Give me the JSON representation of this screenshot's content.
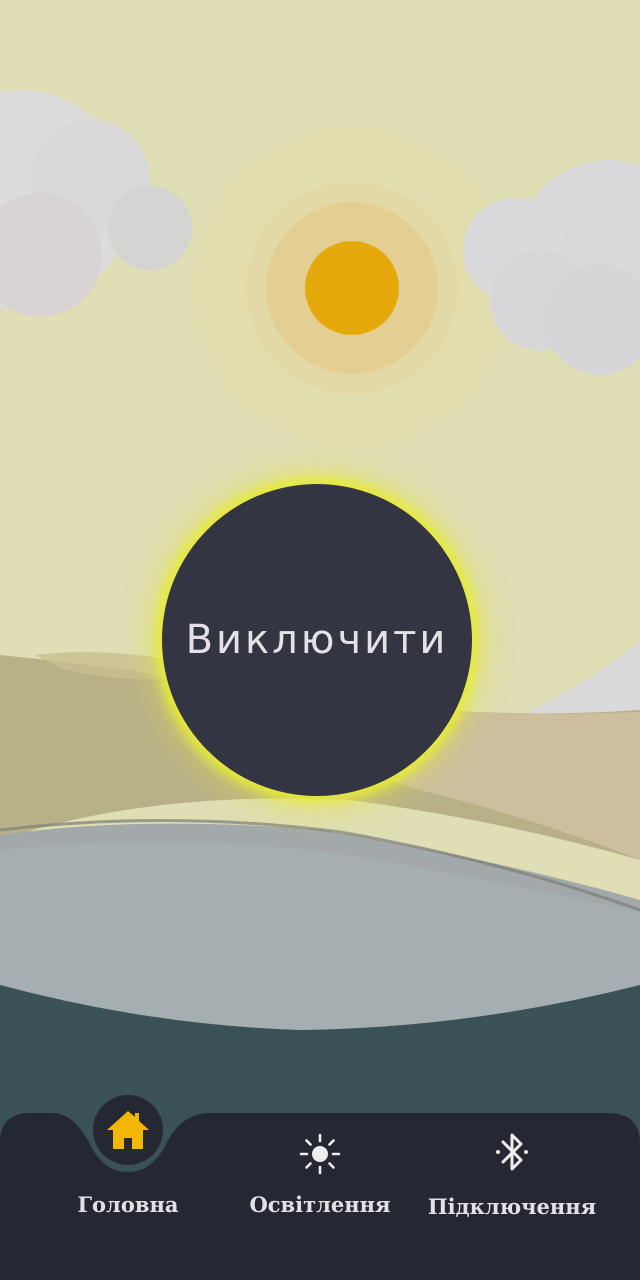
{
  "main": {
    "power_button_label": "Виключити"
  },
  "bottom_nav": {
    "items": [
      {
        "label": "Головна",
        "icon": "home-icon",
        "active": true
      },
      {
        "label": "Освітлення",
        "icon": "sun-icon",
        "active": false
      },
      {
        "label": "Підключення",
        "icon": "bluetooth-icon",
        "active": false
      }
    ]
  },
  "colors": {
    "sky": "#dfdeb4",
    "sun": "#e6a90c",
    "accent_glow": "#e6ea3a",
    "button": "#333642",
    "navbar": "#252833",
    "active_icon": "#f2b705"
  }
}
